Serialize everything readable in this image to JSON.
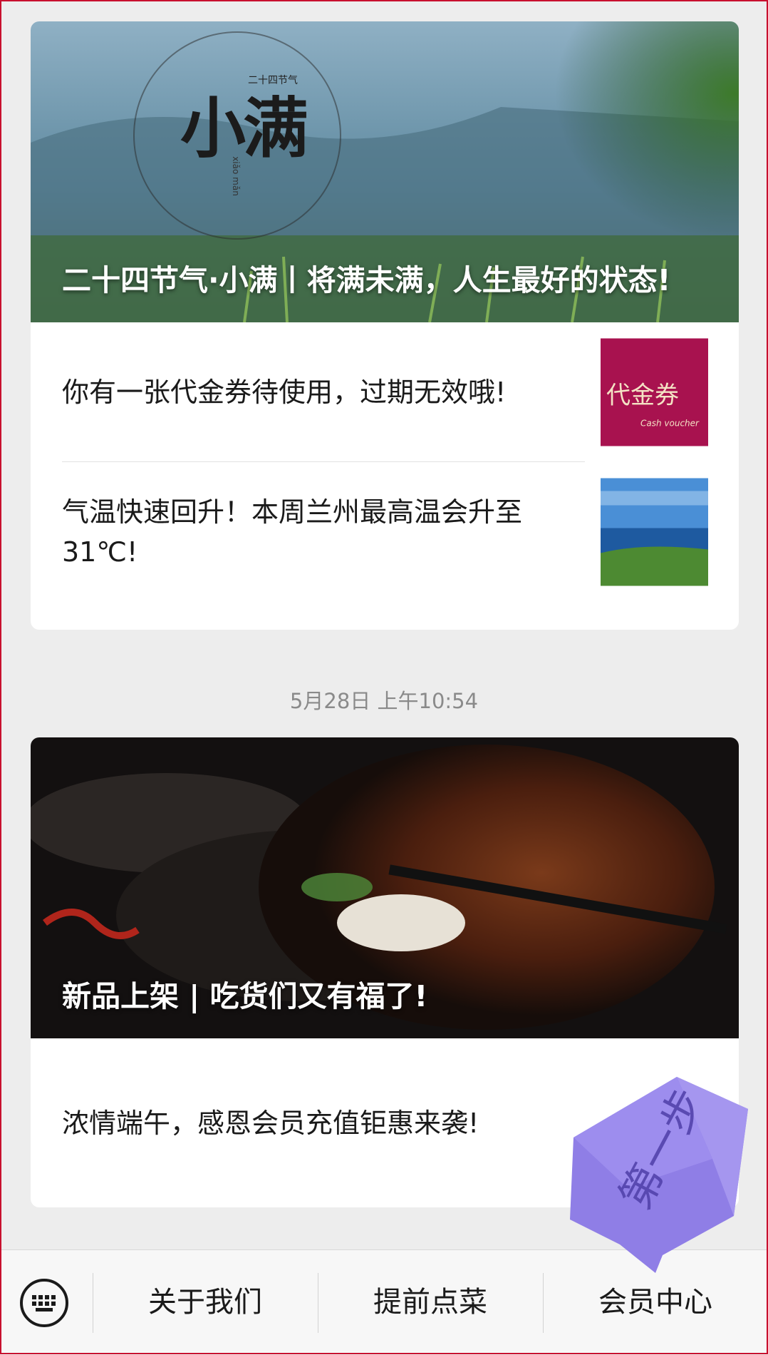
{
  "feed": {
    "card1": {
      "hero_title": "二十四节气·小满丨将满未满，人生最好的状态!",
      "hero_logo": {
        "big_chars": "小满",
        "small_chars": "二十四节气",
        "side_chars": "xiǎo mǎn"
      },
      "items": [
        {
          "title": "你有一张代金券待使用，过期无效哦!",
          "thumb_main": "代金券",
          "thumb_sub": "Cash voucher"
        },
        {
          "title": "气温快速回升！本周兰州最高温会升至31℃!"
        }
      ]
    },
    "timestamp": "5月28日 上午10:54",
    "card2": {
      "hero_title": "新品上架 | 吃货们又有福了!",
      "items": [
        {
          "title": "浓情端午，感恩会员充值钜惠来袭!"
        }
      ]
    }
  },
  "bottom_menu": {
    "keyboard_icon": "keyboard-icon",
    "items": [
      "关于我们",
      "提前点菜",
      "会员中心"
    ]
  },
  "overlay": {
    "sticker_text": "第一步",
    "color": "#8f7ee6"
  }
}
